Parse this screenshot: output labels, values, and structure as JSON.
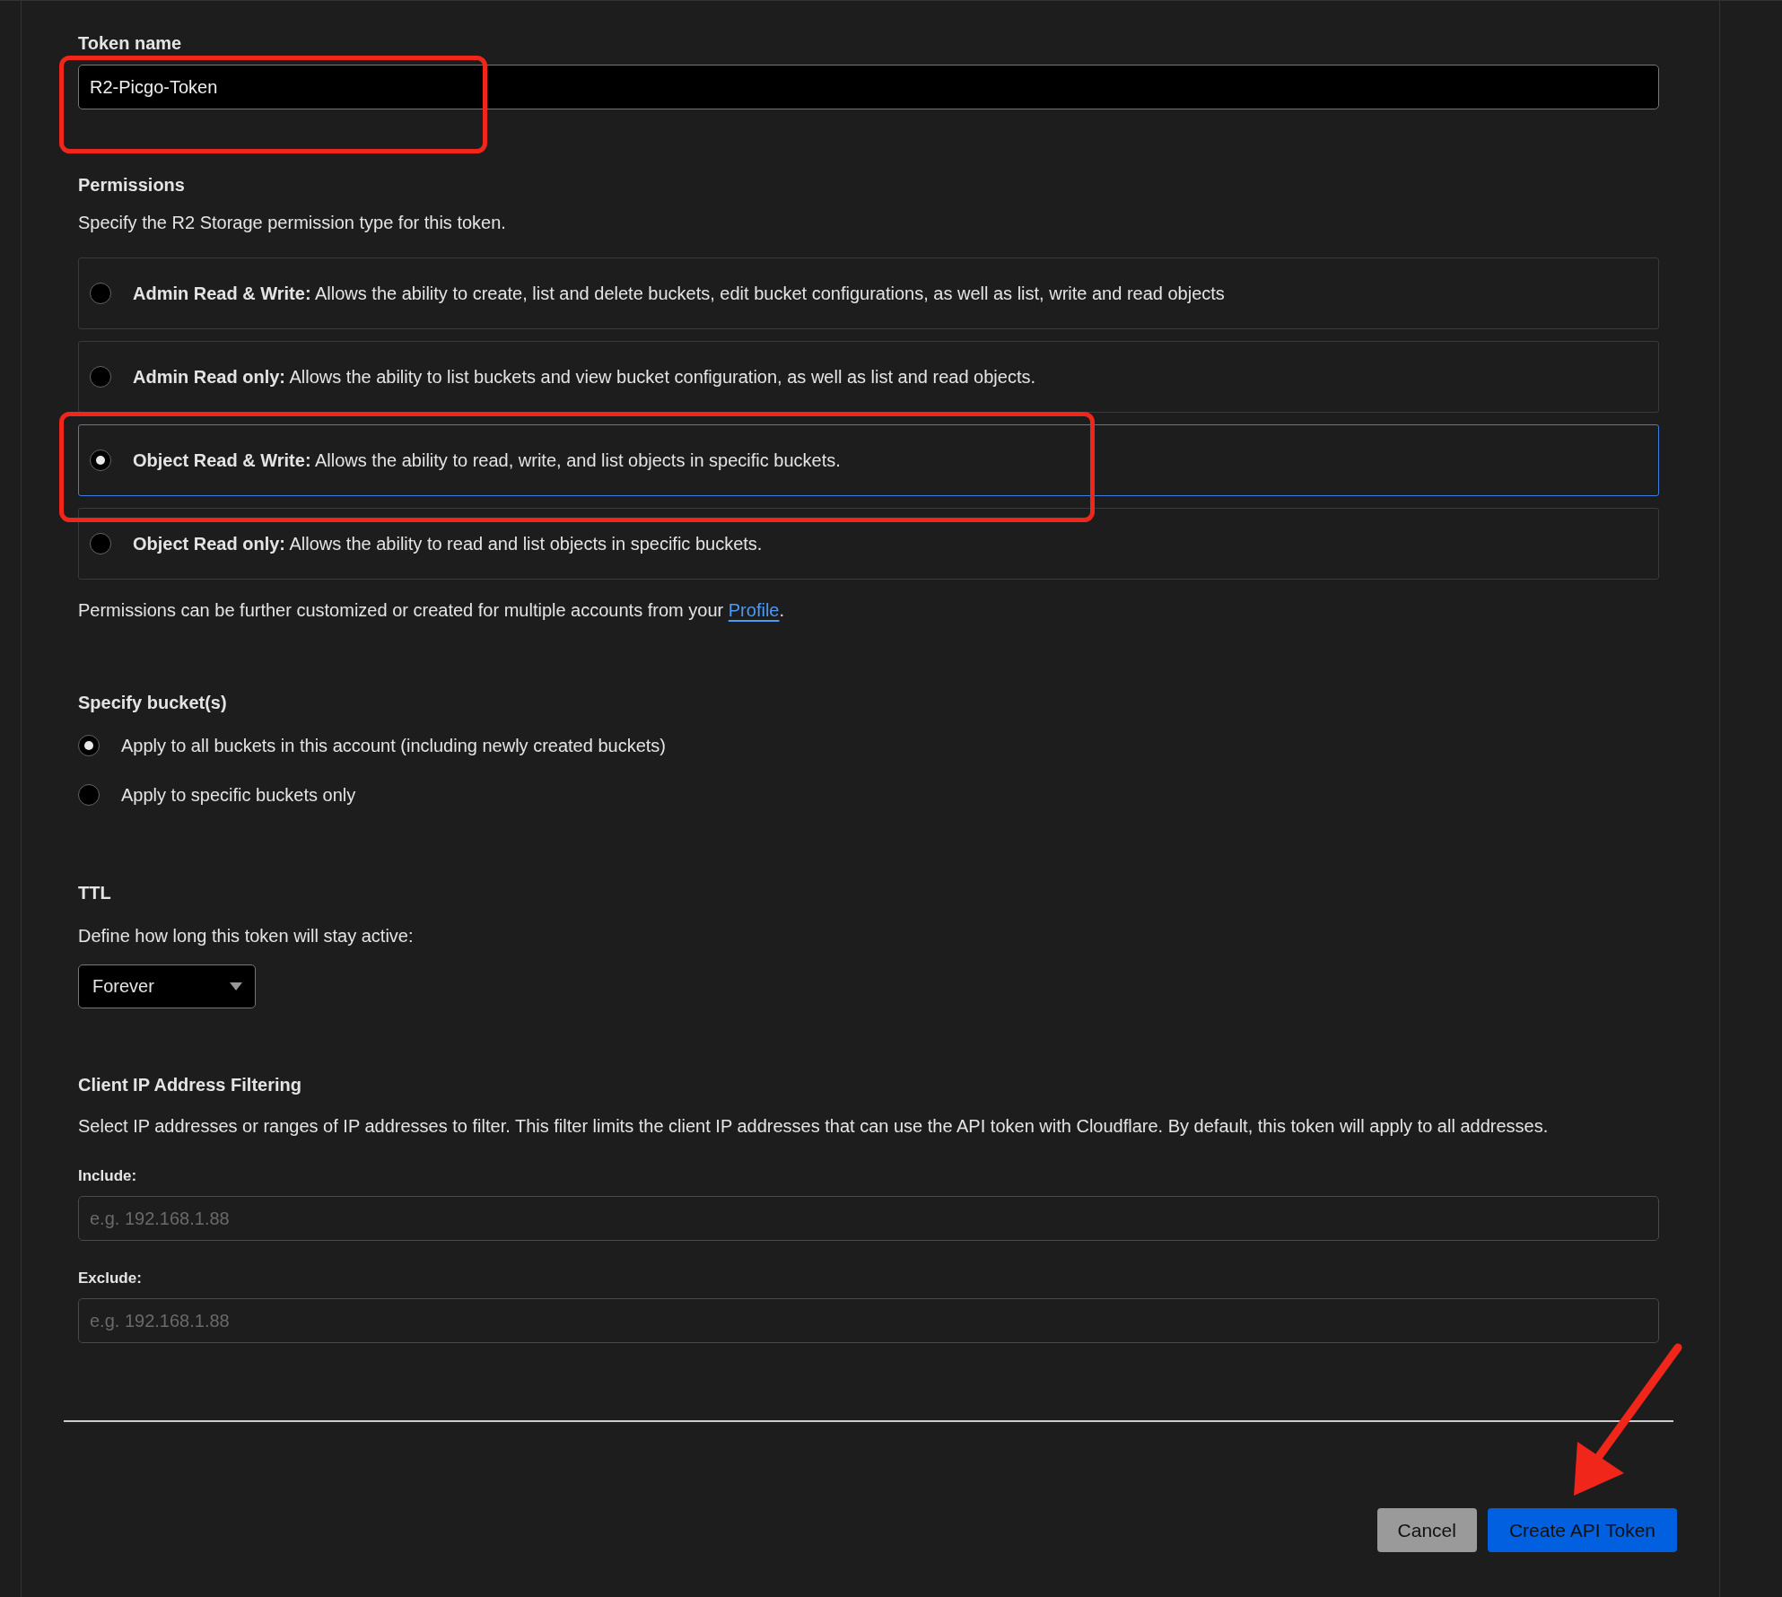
{
  "token_name": {
    "label": "Token name",
    "value": "R2-Picgo-Token"
  },
  "permissions": {
    "title": "Permissions",
    "description": "Specify the R2 Storage permission type for this token.",
    "options": [
      {
        "name": "Admin Read & Write:",
        "text": "Allows the ability to create, list and delete buckets, edit bucket configurations, as well as list, write and read objects",
        "selected": false
      },
      {
        "name": "Admin Read only:",
        "text": "Allows the ability to list buckets and view bucket configuration, as well as list and read objects.",
        "selected": false
      },
      {
        "name": "Object Read & Write:",
        "text": "Allows the ability to read, write, and list objects in specific buckets.",
        "selected": true
      },
      {
        "name": "Object Read only:",
        "text": "Allows the ability to read and list objects in specific buckets.",
        "selected": false
      }
    ],
    "note": "Permissions can be further customized or created for multiple accounts from your",
    "note_link": "Profile",
    "note_end": "."
  },
  "buckets": {
    "title": "Specify bucket(s)",
    "options": [
      {
        "label": "Apply to all buckets in this account (including newly created buckets)",
        "selected": true
      },
      {
        "label": "Apply to specific buckets only",
        "selected": false
      }
    ]
  },
  "ttl": {
    "title": "TTL",
    "description": "Define how long this token will stay active:",
    "value": "Forever"
  },
  "ip_filtering": {
    "title": "Client IP Address Filtering",
    "description": "Select IP addresses or ranges of IP addresses to filter. This filter limits the client IP addresses that can use the API token with Cloudflare. By default, this token will apply to all addresses.",
    "fields": [
      {
        "label": "Include:",
        "placeholder": "e.g. 192.168.1.88"
      },
      {
        "label": "Exclude:",
        "placeholder": "e.g. 192.168.1.88"
      }
    ]
  },
  "buttons": [
    {
      "label": "Cancel",
      "kind": "secondary"
    },
    {
      "label": "Create API Token",
      "kind": "primary"
    }
  ],
  "annotations": [
    {
      "kind": "box"
    },
    {
      "kind": "box"
    },
    {
      "kind": "arrow"
    }
  ]
}
